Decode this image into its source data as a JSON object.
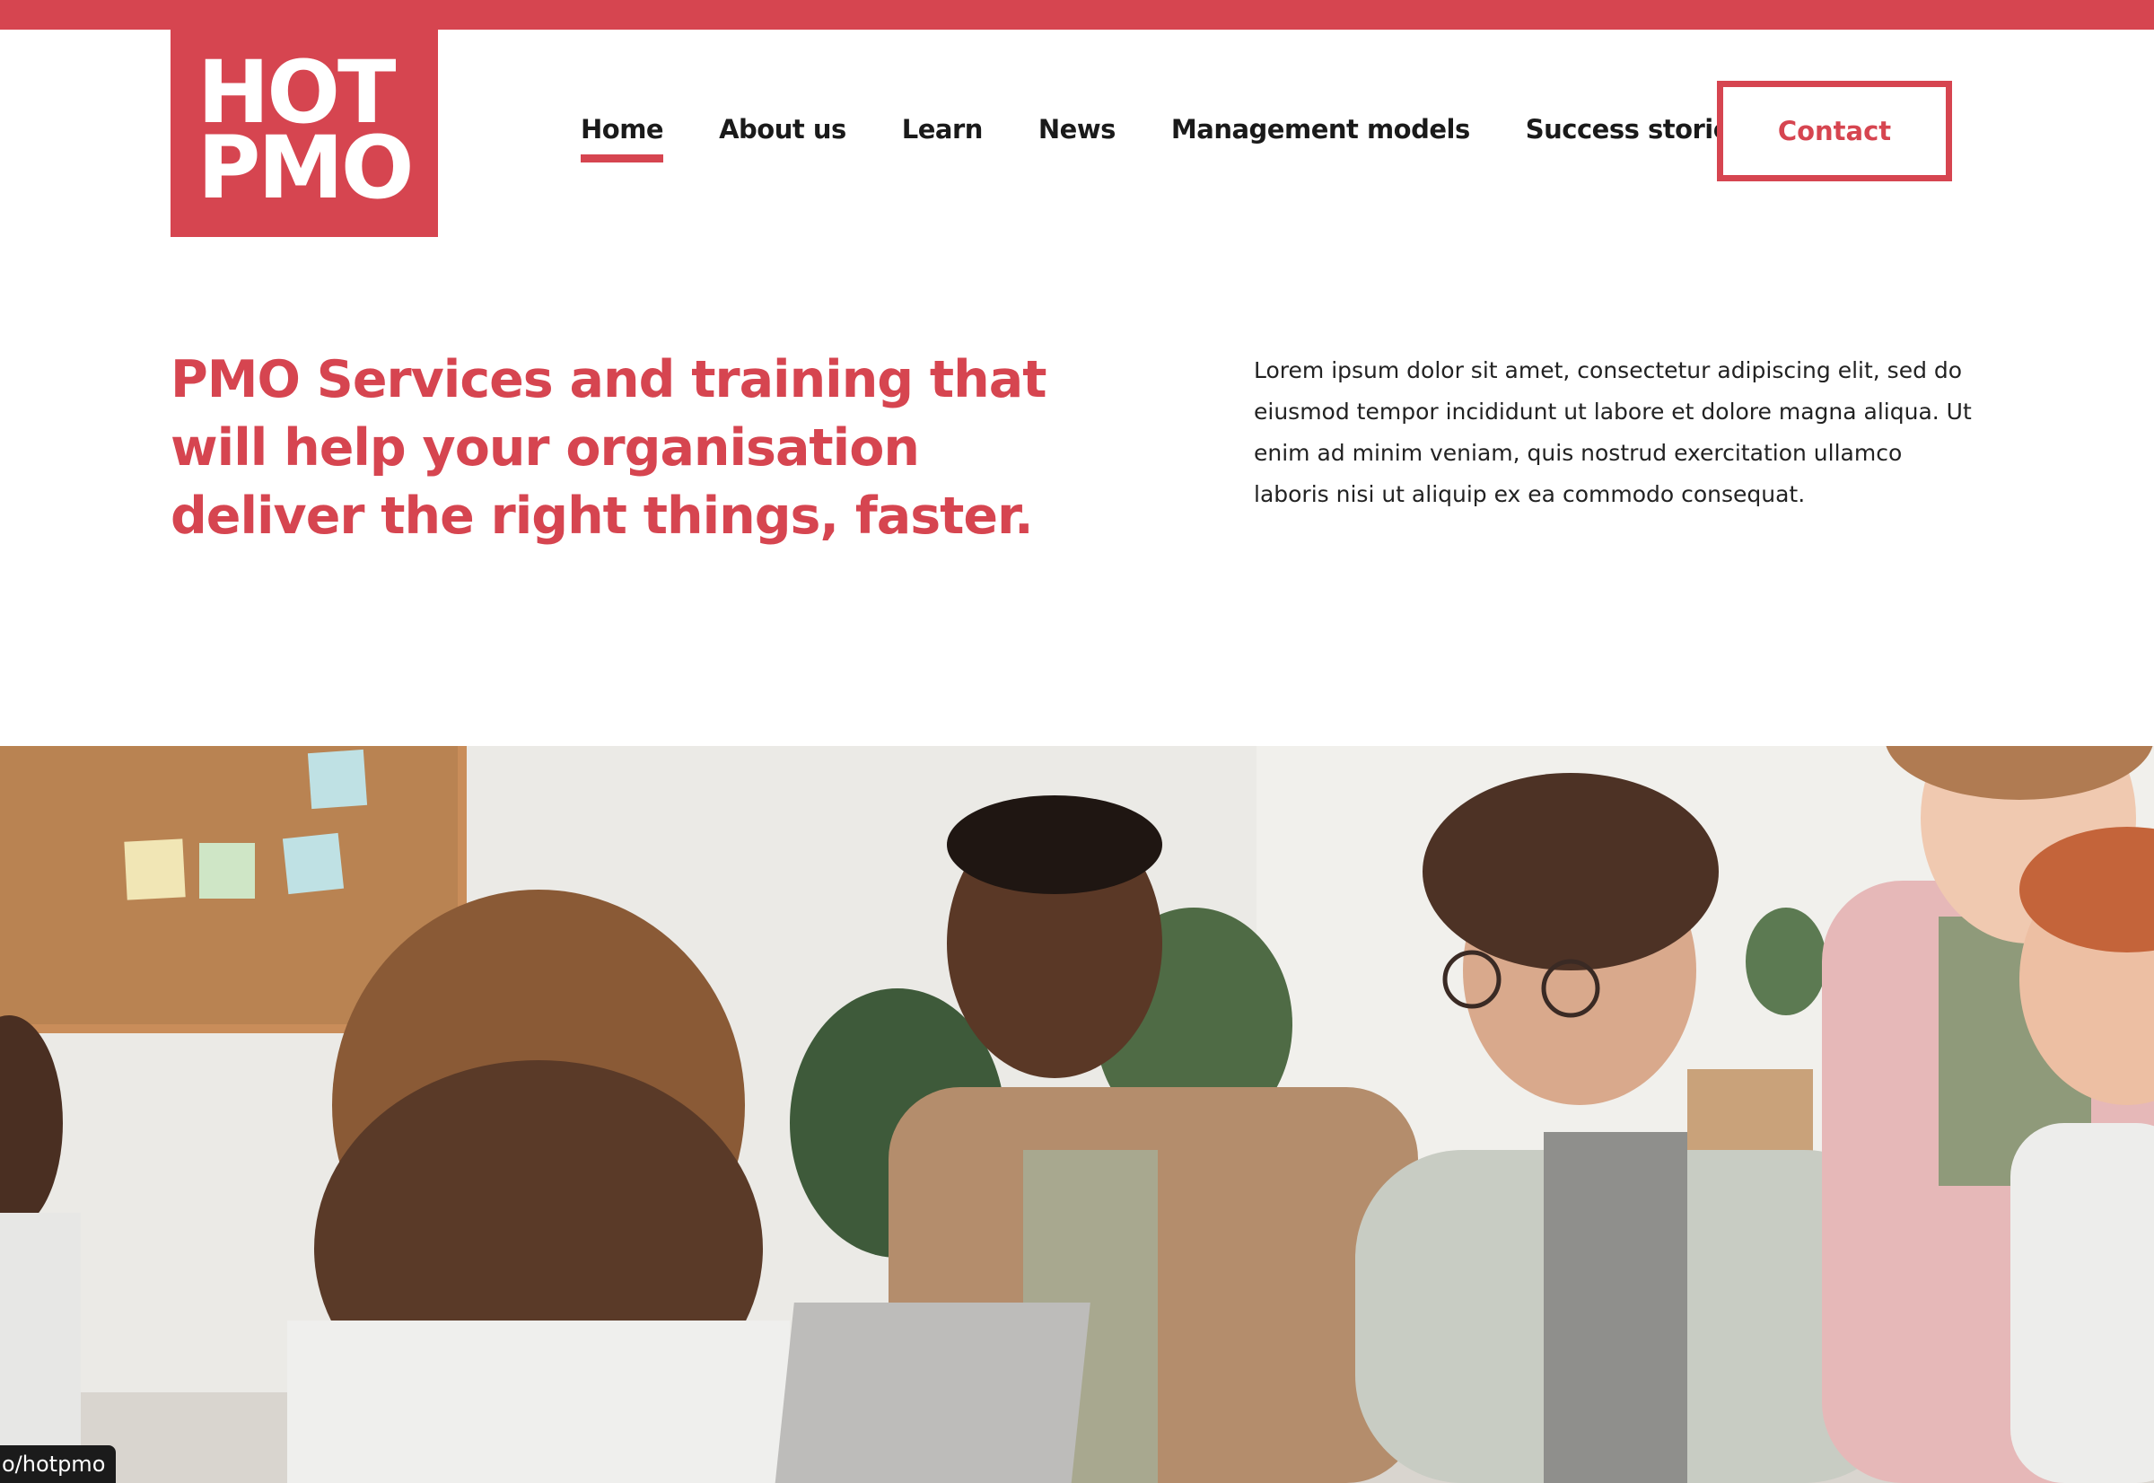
{
  "logo": {
    "line1": "HOT",
    "line2": "PMO",
    "color": "#d64550"
  },
  "nav": {
    "items": [
      {
        "label": "Home",
        "active": true
      },
      {
        "label": "About us",
        "active": false
      },
      {
        "label": "Learn",
        "active": false
      },
      {
        "label": "News",
        "active": false
      },
      {
        "label": "Management models",
        "active": false
      },
      {
        "label": "Success stories",
        "active": false
      }
    ],
    "contact_label": "Contact"
  },
  "hero": {
    "title": "PMO Services and training that will help your organisation deliver the right things, faster.",
    "body": "Lorem ipsum dolor sit amet, consectetur adipiscing elit, sed do eiusmod tempor incididunt ut labore et dolore magna aliqua. Ut enim ad minim veniam, quis nostrud exercitation ullamco laboris nisi ut aliquip ex ea commodo consequat."
  },
  "status": {
    "url_hint": "o/hotpmo"
  },
  "colors": {
    "accent": "#d64550",
    "text": "#1a1a1a"
  }
}
